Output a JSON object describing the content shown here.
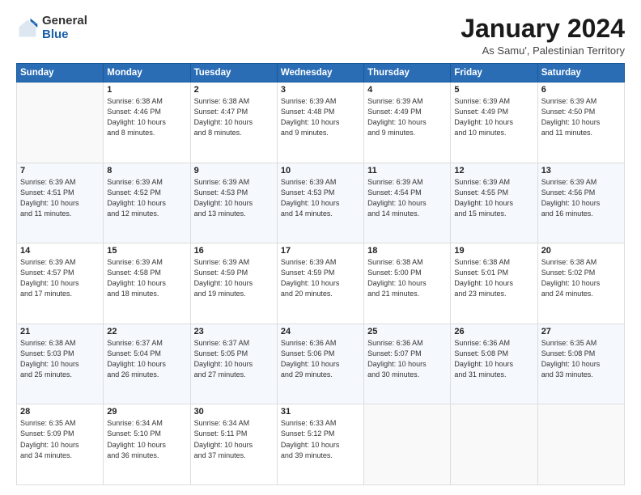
{
  "logo": {
    "general": "General",
    "blue": "Blue"
  },
  "title": "January 2024",
  "subtitle": "As Samu', Palestinian Territory",
  "headers": [
    "Sunday",
    "Monday",
    "Tuesday",
    "Wednesday",
    "Thursday",
    "Friday",
    "Saturday"
  ],
  "weeks": [
    [
      {
        "num": "",
        "info": ""
      },
      {
        "num": "1",
        "info": "Sunrise: 6:38 AM\nSunset: 4:46 PM\nDaylight: 10 hours\nand 8 minutes."
      },
      {
        "num": "2",
        "info": "Sunrise: 6:38 AM\nSunset: 4:47 PM\nDaylight: 10 hours\nand 8 minutes."
      },
      {
        "num": "3",
        "info": "Sunrise: 6:39 AM\nSunset: 4:48 PM\nDaylight: 10 hours\nand 9 minutes."
      },
      {
        "num": "4",
        "info": "Sunrise: 6:39 AM\nSunset: 4:49 PM\nDaylight: 10 hours\nand 9 minutes."
      },
      {
        "num": "5",
        "info": "Sunrise: 6:39 AM\nSunset: 4:49 PM\nDaylight: 10 hours\nand 10 minutes."
      },
      {
        "num": "6",
        "info": "Sunrise: 6:39 AM\nSunset: 4:50 PM\nDaylight: 10 hours\nand 11 minutes."
      }
    ],
    [
      {
        "num": "7",
        "info": "Sunrise: 6:39 AM\nSunset: 4:51 PM\nDaylight: 10 hours\nand 11 minutes."
      },
      {
        "num": "8",
        "info": "Sunrise: 6:39 AM\nSunset: 4:52 PM\nDaylight: 10 hours\nand 12 minutes."
      },
      {
        "num": "9",
        "info": "Sunrise: 6:39 AM\nSunset: 4:53 PM\nDaylight: 10 hours\nand 13 minutes."
      },
      {
        "num": "10",
        "info": "Sunrise: 6:39 AM\nSunset: 4:53 PM\nDaylight: 10 hours\nand 14 minutes."
      },
      {
        "num": "11",
        "info": "Sunrise: 6:39 AM\nSunset: 4:54 PM\nDaylight: 10 hours\nand 14 minutes."
      },
      {
        "num": "12",
        "info": "Sunrise: 6:39 AM\nSunset: 4:55 PM\nDaylight: 10 hours\nand 15 minutes."
      },
      {
        "num": "13",
        "info": "Sunrise: 6:39 AM\nSunset: 4:56 PM\nDaylight: 10 hours\nand 16 minutes."
      }
    ],
    [
      {
        "num": "14",
        "info": "Sunrise: 6:39 AM\nSunset: 4:57 PM\nDaylight: 10 hours\nand 17 minutes."
      },
      {
        "num": "15",
        "info": "Sunrise: 6:39 AM\nSunset: 4:58 PM\nDaylight: 10 hours\nand 18 minutes."
      },
      {
        "num": "16",
        "info": "Sunrise: 6:39 AM\nSunset: 4:59 PM\nDaylight: 10 hours\nand 19 minutes."
      },
      {
        "num": "17",
        "info": "Sunrise: 6:39 AM\nSunset: 4:59 PM\nDaylight: 10 hours\nand 20 minutes."
      },
      {
        "num": "18",
        "info": "Sunrise: 6:38 AM\nSunset: 5:00 PM\nDaylight: 10 hours\nand 21 minutes."
      },
      {
        "num": "19",
        "info": "Sunrise: 6:38 AM\nSunset: 5:01 PM\nDaylight: 10 hours\nand 23 minutes."
      },
      {
        "num": "20",
        "info": "Sunrise: 6:38 AM\nSunset: 5:02 PM\nDaylight: 10 hours\nand 24 minutes."
      }
    ],
    [
      {
        "num": "21",
        "info": "Sunrise: 6:38 AM\nSunset: 5:03 PM\nDaylight: 10 hours\nand 25 minutes."
      },
      {
        "num": "22",
        "info": "Sunrise: 6:37 AM\nSunset: 5:04 PM\nDaylight: 10 hours\nand 26 minutes."
      },
      {
        "num": "23",
        "info": "Sunrise: 6:37 AM\nSunset: 5:05 PM\nDaylight: 10 hours\nand 27 minutes."
      },
      {
        "num": "24",
        "info": "Sunrise: 6:36 AM\nSunset: 5:06 PM\nDaylight: 10 hours\nand 29 minutes."
      },
      {
        "num": "25",
        "info": "Sunrise: 6:36 AM\nSunset: 5:07 PM\nDaylight: 10 hours\nand 30 minutes."
      },
      {
        "num": "26",
        "info": "Sunrise: 6:36 AM\nSunset: 5:08 PM\nDaylight: 10 hours\nand 31 minutes."
      },
      {
        "num": "27",
        "info": "Sunrise: 6:35 AM\nSunset: 5:08 PM\nDaylight: 10 hours\nand 33 minutes."
      }
    ],
    [
      {
        "num": "28",
        "info": "Sunrise: 6:35 AM\nSunset: 5:09 PM\nDaylight: 10 hours\nand 34 minutes."
      },
      {
        "num": "29",
        "info": "Sunrise: 6:34 AM\nSunset: 5:10 PM\nDaylight: 10 hours\nand 36 minutes."
      },
      {
        "num": "30",
        "info": "Sunrise: 6:34 AM\nSunset: 5:11 PM\nDaylight: 10 hours\nand 37 minutes."
      },
      {
        "num": "31",
        "info": "Sunrise: 6:33 AM\nSunset: 5:12 PM\nDaylight: 10 hours\nand 39 minutes."
      },
      {
        "num": "",
        "info": ""
      },
      {
        "num": "",
        "info": ""
      },
      {
        "num": "",
        "info": ""
      }
    ]
  ]
}
